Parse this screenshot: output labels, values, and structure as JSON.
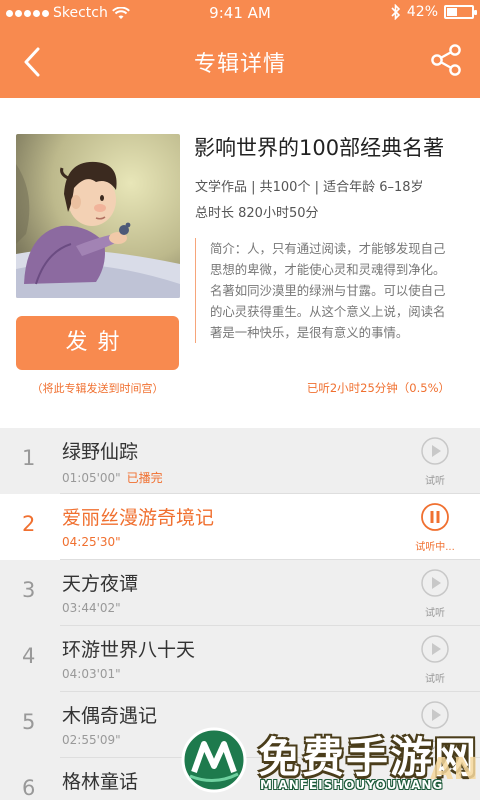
{
  "status_bar": {
    "carrier": "Skectch",
    "time": "9:41 AM",
    "battery": "42%",
    "battery_level": 0.42
  },
  "nav": {
    "title": "专辑详情",
    "back_icon": "chevron-left-icon",
    "share_icon": "share-icon"
  },
  "album": {
    "title": "影响世界的100部经典名著",
    "meta_line1": "文学作品 | 共100个 | 适合年龄 6–18岁",
    "meta_line2": "总时长 820小时50分",
    "description": "简介：人，只有通过阅读，才能够发现自己思想的卑微，才能使心灵和灵魂得到净化。名著如同沙漠里的绿洲与甘露。可以使自己的心灵获得重生。从这个意义上说，阅读名著是一种快乐，是很有意义的事情。",
    "listened": "已听2小时25分钟（0.5%）",
    "fire_button": "发射",
    "fire_hint": "（将此专辑发送到时间宫）"
  },
  "tracks": [
    {
      "num": "1",
      "name": "绿野仙踪",
      "duration": "01:05'00\"",
      "played": "已播完",
      "control": "试听",
      "active": false
    },
    {
      "num": "2",
      "name": "爱丽丝漫游奇境记",
      "duration": "04:25'30\"",
      "played": "",
      "control": "试听中...",
      "active": true
    },
    {
      "num": "3",
      "name": "天方夜谭",
      "duration": "03:44'02\"",
      "played": "",
      "control": "试听",
      "active": false
    },
    {
      "num": "4",
      "name": "环游世界八十天",
      "duration": "04:03'01\"",
      "played": "",
      "control": "试听",
      "active": false
    },
    {
      "num": "5",
      "name": "木偶奇遇记",
      "duration": "02:55'09\"",
      "played": "",
      "control": "试听",
      "active": false
    },
    {
      "num": "6",
      "name": "格林童话",
      "duration": "",
      "played": "",
      "control": "",
      "active": false
    }
  ],
  "watermark": {
    "text": "免费手游网",
    "subtext": "MIANFEISHOUYOUWANG",
    "corner": "AN"
  },
  "colors": {
    "accent": "#f88a4f",
    "accent_text": "#f07030"
  }
}
